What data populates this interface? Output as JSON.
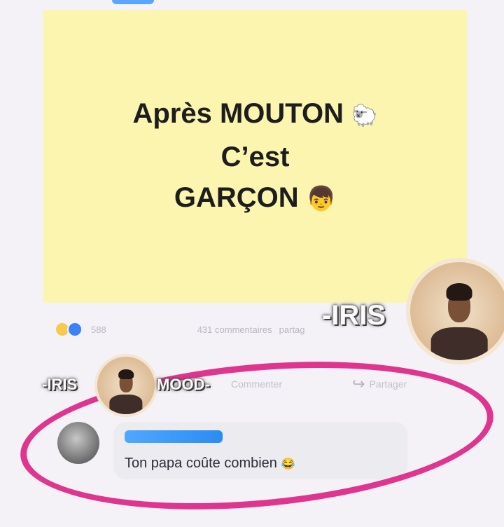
{
  "post": {
    "line1": "Après MOUTON",
    "line2": "C’est",
    "line3": "GARÇON",
    "sheep_icon": "sheep-emoji",
    "boy_icon": "boy-emoji",
    "background_color": "#fbf5b0"
  },
  "stats": {
    "reactions_count": "588",
    "comments_count": "431 commentaires",
    "shares_partial": "partag"
  },
  "actions": {
    "comment_label": "Commenter",
    "share_label": "Partager"
  },
  "comment": {
    "text": "Ton papa coûte combien"
  },
  "watermarks": {
    "iris_large": "-IRIS",
    "iris_small": "-IRIS",
    "mood": "MOOD-"
  },
  "highlight_color": "#e0358f"
}
